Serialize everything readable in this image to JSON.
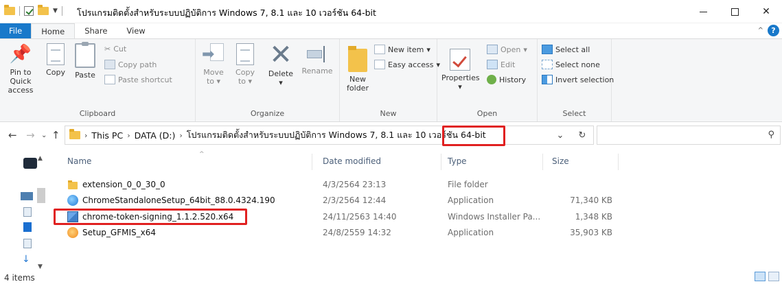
{
  "window": {
    "title": "โปรแกรมติดตั้งสำหรับระบบปฏิบัติการ Windows 7, 8.1 และ 10 เวอร์ชัน 64-bit",
    "minimize": "—",
    "close": "✕"
  },
  "tabs": {
    "file": "File",
    "home": "Home",
    "share": "Share",
    "view": "View"
  },
  "ribbon": {
    "clipboard": {
      "label": "Clipboard",
      "pin": "Pin to Quick access",
      "copy": "Copy",
      "paste": "Paste",
      "cut": "Cut",
      "copy_path": "Copy path",
      "paste_shortcut": "Paste shortcut"
    },
    "organize": {
      "label": "Organize",
      "move_to": "Move to",
      "copy_to": "Copy to",
      "delete": "Delete",
      "rename": "Rename"
    },
    "new": {
      "label": "New",
      "new_folder": "New folder",
      "new_item": "New item",
      "easy_access": "Easy access"
    },
    "open": {
      "label": "Open",
      "properties": "Properties",
      "open": "Open",
      "edit": "Edit",
      "history": "History"
    },
    "select": {
      "label": "Select",
      "select_all": "Select all",
      "select_none": "Select none",
      "invert": "Invert selection"
    }
  },
  "address": {
    "crumbs": [
      "This PC",
      "DATA (D:)",
      "โปรแกรมติดตั้งสำหรับระบบปฏิบัติการ Windows 7, 8.1 และ 10 เวอร์ชัน 64-bit"
    ],
    "search_placeholder": ""
  },
  "columns": {
    "name": "Name",
    "date": "Date modified",
    "type": "Type",
    "size": "Size"
  },
  "files": [
    {
      "name": "extension_0_0_30_0",
      "date": "4/3/2564 23:13",
      "type": "File folder",
      "size": "",
      "icon": "folder-icon"
    },
    {
      "name": "ChromeStandaloneSetup_64bit_88.0.4324.190",
      "date": "2/3/2564 12:44",
      "type": "Application",
      "size": "71,340 KB",
      "icon": "setup-app-icon"
    },
    {
      "name": "chrome-token-signing_1.1.2.520.x64",
      "date": "24/11/2563 14:40",
      "type": "Windows Installer Pa...",
      "size": "1,348 KB",
      "icon": "msi-installer-icon"
    },
    {
      "name": "Setup_GFMIS_x64",
      "date": "24/8/2559 14:32",
      "type": "Application",
      "size": "35,903 KB",
      "icon": "gfmis-app-icon"
    }
  ],
  "status": {
    "items": "4 items"
  },
  "colors": {
    "accent": "#1979ca",
    "highlight": "#e02020",
    "folder": "#f3c24b"
  }
}
